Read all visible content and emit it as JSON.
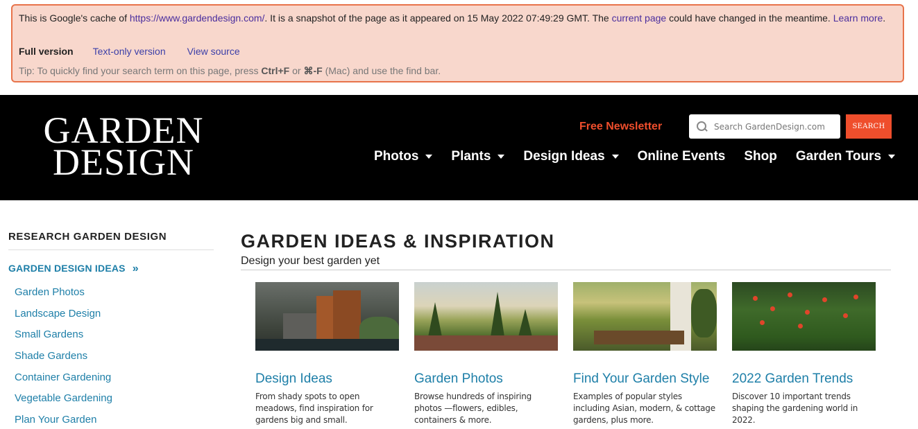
{
  "cache_banner": {
    "text_prefix": "This is Google's cache of ",
    "cached_url": "https://www.gardendesign.com/",
    "text_mid": ". It is a snapshot of the page as it appeared on 15 May 2022 07:49:29 GMT. The ",
    "current_page_link": "current page",
    "text_suffix": " could have changed in the meantime. ",
    "learn_more_link": "Learn more",
    "learn_more_end": ".",
    "full_version": "Full version",
    "text_only_version": "Text-only version",
    "view_source": "View source",
    "tip_prefix": "Tip: To quickly find your search term on this page, press ",
    "tip_key1": "Ctrl+F",
    "tip_or": " or ",
    "tip_key2": "⌘-F",
    "tip_suffix": " (Mac) and use the find bar."
  },
  "header": {
    "logo_line1": "GARDEN",
    "logo_line2": "DESIGN",
    "newsletter": "Free Newsletter",
    "search_placeholder": "Search GardenDesign.com",
    "search_button": "SEARCH",
    "nav": [
      {
        "label": "Photos",
        "has_dropdown": true
      },
      {
        "label": "Plants",
        "has_dropdown": true
      },
      {
        "label": "Design Ideas",
        "has_dropdown": true
      },
      {
        "label": "Online Events",
        "has_dropdown": false
      },
      {
        "label": "Shop",
        "has_dropdown": false
      },
      {
        "label": "Garden Tours",
        "has_dropdown": true
      }
    ]
  },
  "sidebar": {
    "title": "RESEARCH GARDEN DESIGN",
    "active": "GARDEN DESIGN IDEAS",
    "active_icon": "»",
    "items": [
      "Garden Photos",
      "Landscape Design",
      "Small Gardens",
      "Shade Gardens",
      "Container Gardening",
      "Vegetable Gardening",
      "Plan Your Garden"
    ]
  },
  "main": {
    "title": "GARDEN IDEAS & INSPIRATION",
    "subtitle": "Design your best garden yet",
    "cards": [
      {
        "title": "Design Ideas",
        "desc": "From shady spots to open meadows, find inspiration for gardens big and small."
      },
      {
        "title": "Garden Photos",
        "desc": "Browse hundreds of inspiring photos —flowers, edibles, containers & more."
      },
      {
        "title": "Find Your Garden Style",
        "desc": "Examples of popular styles including Asian, modern, & cottage gardens, plus more."
      },
      {
        "title": "2022 Garden Trends",
        "desc": "Discover 10 important trends shaping the gardening world in 2022."
      }
    ]
  },
  "colors": {
    "accent_orange": "#ef4e2c",
    "link_blue": "#1e7fa8",
    "banner_bg": "#f8d7cc",
    "banner_border": "#e8734a"
  }
}
